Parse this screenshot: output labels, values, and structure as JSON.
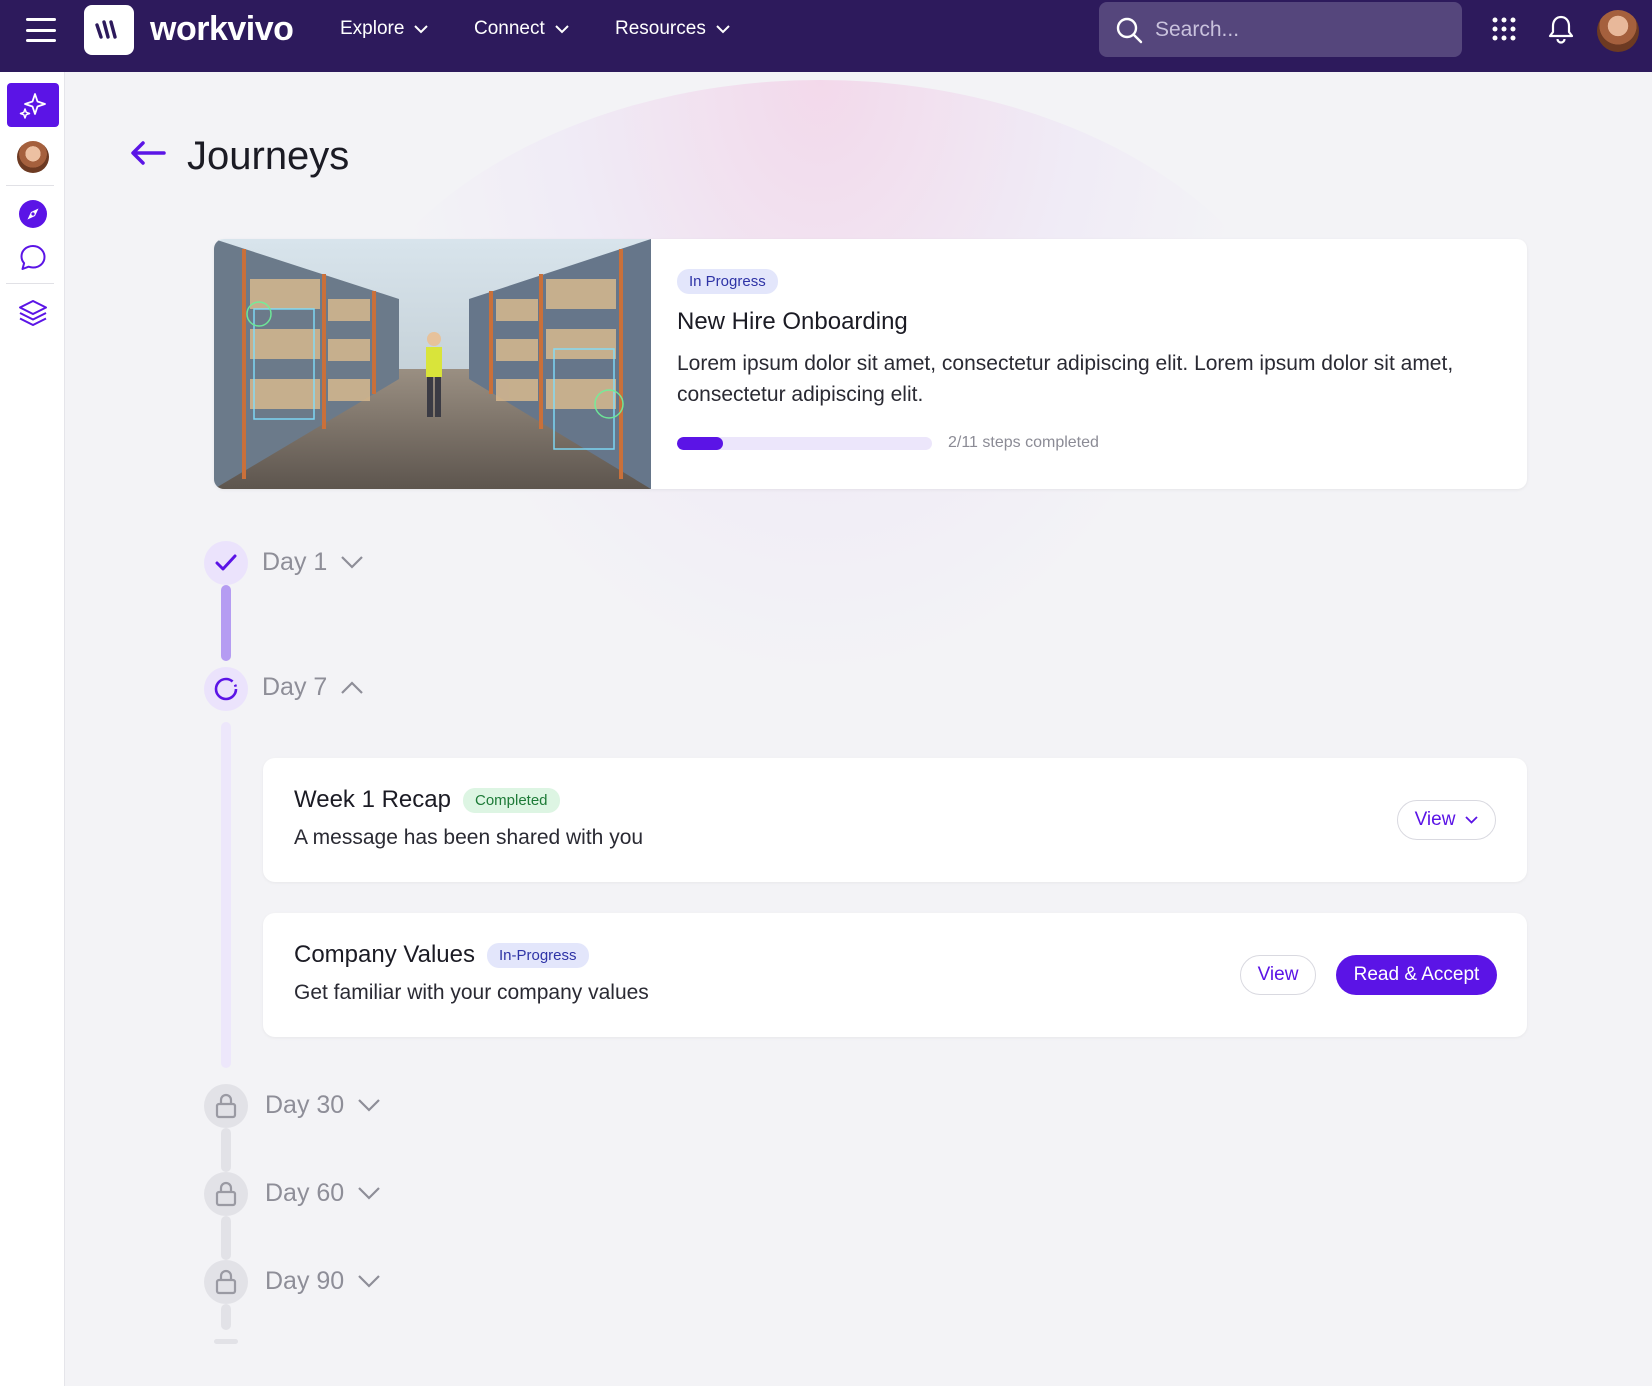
{
  "app": {
    "name": "workvivo",
    "logo_icon": "workvivo-logo-icon"
  },
  "nav": {
    "items": [
      {
        "label": "Explore"
      },
      {
        "label": "Connect"
      },
      {
        "label": "Resources"
      }
    ],
    "search_placeholder": "Search..."
  },
  "page": {
    "title": "Journeys"
  },
  "journey": {
    "status": "In Progress",
    "title": "New Hire Onboarding",
    "description": "Lorem ipsum dolor sit amet, consectetur adipiscing elit. Lorem ipsum dolor sit amet, consectetur adipiscing elit.",
    "progress_fraction": 0.18,
    "progress_text": "2/11 steps completed"
  },
  "timeline": {
    "day1": {
      "label": "Day 1",
      "state": "completed"
    },
    "day7": {
      "label": "Day 7",
      "state": "in-progress"
    },
    "day30": {
      "label": "Day 30",
      "state": "locked"
    },
    "day60": {
      "label": "Day 60",
      "state": "locked"
    },
    "day90": {
      "label": "Day 90",
      "state": "locked"
    }
  },
  "steps": [
    {
      "title": "Week 1 Recap",
      "badge": "Completed",
      "description": "A message has been shared with you",
      "view_label": "View"
    },
    {
      "title": "Company Values",
      "badge": "In-Progress",
      "description": "Get familiar with your company values",
      "view_label": "View",
      "accept_label": "Read & Accept"
    }
  ],
  "colors": {
    "brand_purple": "#5b14e6",
    "topbar": "#2d1a5c"
  }
}
